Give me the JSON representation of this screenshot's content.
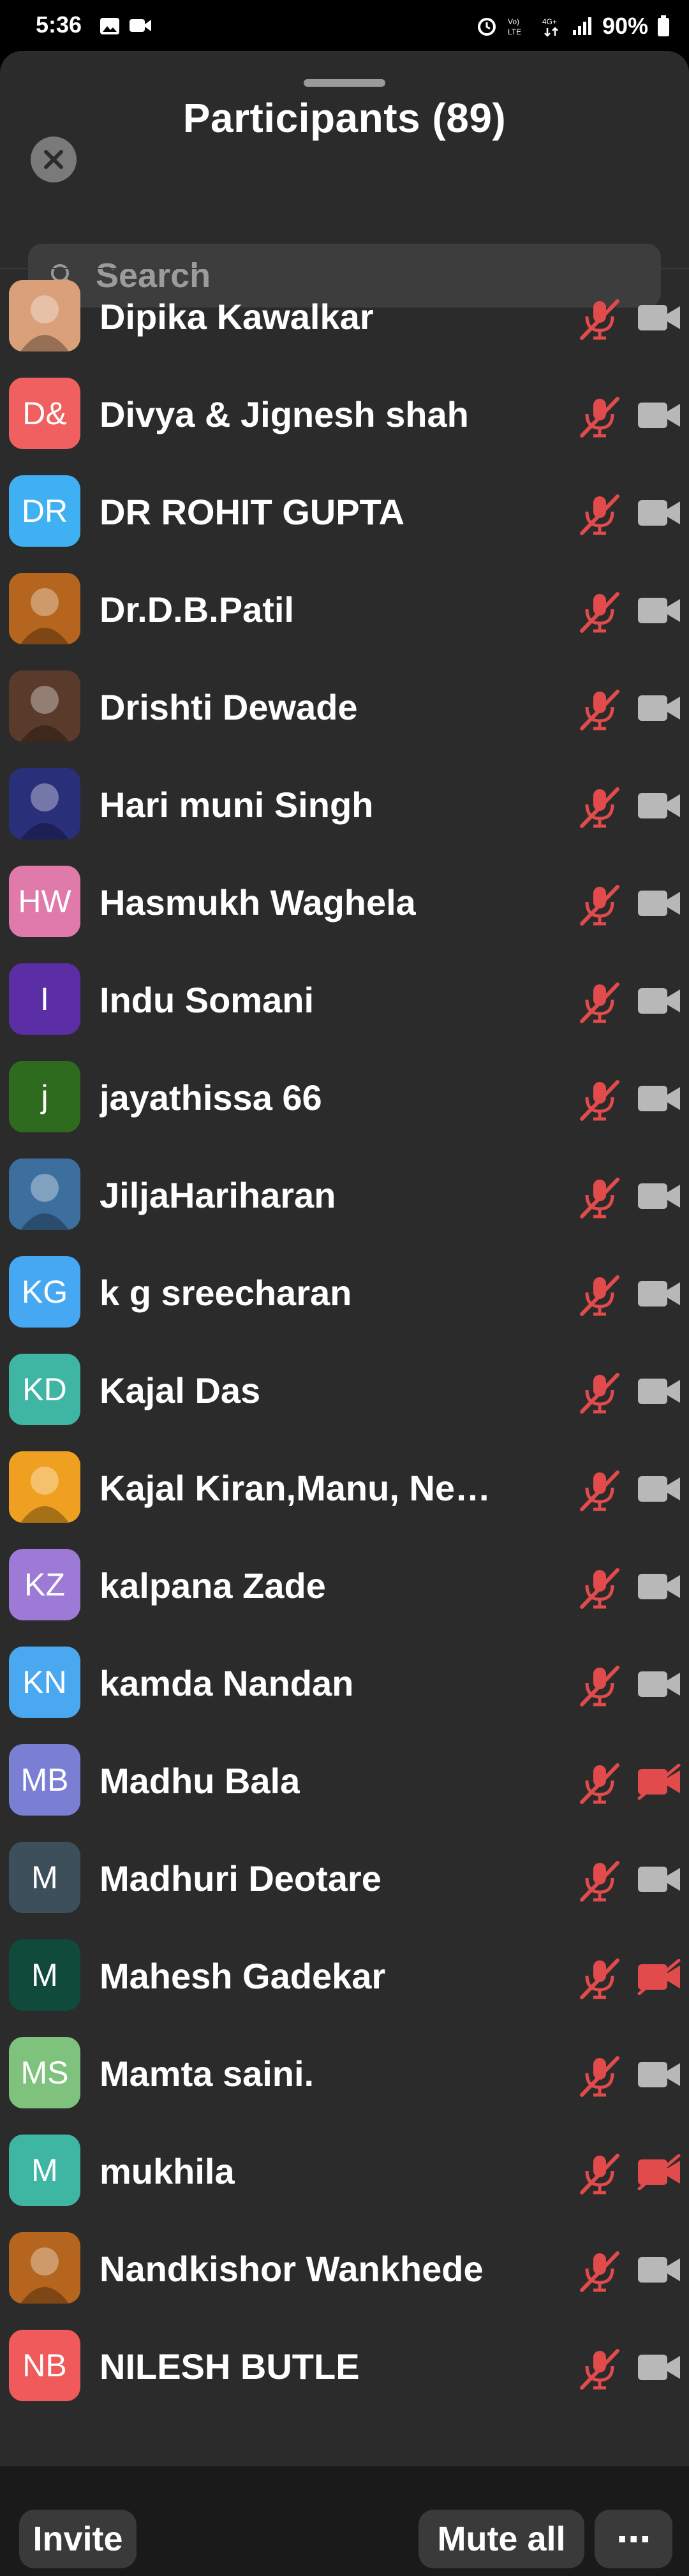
{
  "status_bar": {
    "time": "5:36",
    "battery": "90%"
  },
  "sheet": {
    "title": "Participants (89)",
    "search_placeholder": "Search"
  },
  "participants": [
    {
      "name": "Dipika Kawalkar",
      "initials": "",
      "avatar_color": "#d9a07a",
      "avatar_type": "photo",
      "video_off": false
    },
    {
      "name": "Divya & Jignesh shah",
      "initials": "D&",
      "avatar_color": "#f06060",
      "avatar_type": "initials",
      "video_off": false
    },
    {
      "name": "DR ROHIT GUPTA",
      "initials": "DR",
      "avatar_color": "#3fb1f2",
      "avatar_type": "initials",
      "video_off": false
    },
    {
      "name": "Dr.D.B.Patil",
      "initials": "",
      "avatar_color": "#b5651d",
      "avatar_type": "photo",
      "video_off": false
    },
    {
      "name": "Drishti Dewade",
      "initials": "",
      "avatar_color": "#5a3a2a",
      "avatar_type": "photo",
      "video_off": false
    },
    {
      "name": "Hari muni Singh",
      "initials": "",
      "avatar_color": "#2a2f7a",
      "avatar_type": "photo",
      "video_off": false
    },
    {
      "name": "Hasmukh Waghela",
      "initials": "HW",
      "avatar_color": "#e07aaa",
      "avatar_type": "initials",
      "video_off": false
    },
    {
      "name": "Indu Somani",
      "initials": "I",
      "avatar_color": "#5b2ea6",
      "avatar_type": "initials",
      "video_off": false
    },
    {
      "name": "jayathissa 66",
      "initials": "j",
      "avatar_color": "#2e6b1f",
      "avatar_type": "initials",
      "video_off": false
    },
    {
      "name": "JiljaHariharan",
      "initials": "",
      "avatar_color": "#3d6f9e",
      "avatar_type": "photo",
      "video_off": false
    },
    {
      "name": "k g sreecharan",
      "initials": "KG",
      "avatar_color": "#46a7f2",
      "avatar_type": "initials",
      "video_off": false
    },
    {
      "name": "Kajal Das",
      "initials": "KD",
      "avatar_color": "#3fb5a4",
      "avatar_type": "initials",
      "video_off": false
    },
    {
      "name": "Kajal Kiran,Manu, Neha…",
      "initials": "",
      "avatar_color": "#f0a020",
      "avatar_type": "photo",
      "video_off": false
    },
    {
      "name": "kalpana Zade",
      "initials": "KZ",
      "avatar_color": "#9c7ad6",
      "avatar_type": "initials",
      "video_off": false
    },
    {
      "name": "kamda Nandan",
      "initials": "KN",
      "avatar_color": "#4aa8f0",
      "avatar_type": "initials",
      "video_off": false
    },
    {
      "name": "Madhu Bala",
      "initials": "MB",
      "avatar_color": "#7b7fd4",
      "avatar_type": "initials",
      "video_off": true
    },
    {
      "name": "Madhuri Deotare",
      "initials": "M",
      "avatar_color": "#3d4f5a",
      "avatar_type": "initials",
      "video_off": false
    },
    {
      "name": "Mahesh Gadekar",
      "initials": "M",
      "avatar_color": "#0f4a3a",
      "avatar_type": "initials",
      "video_off": true
    },
    {
      "name": "Mamta saini.",
      "initials": "MS",
      "avatar_color": "#7ec27e",
      "avatar_type": "initials",
      "video_off": false
    },
    {
      "name": "mukhila",
      "initials": "M",
      "avatar_color": "#3fb5a4",
      "avatar_type": "initials",
      "video_off": true
    },
    {
      "name": "Nandkishor Wankhede",
      "initials": "",
      "avatar_color": "#b5651d",
      "avatar_type": "photo",
      "video_off": false
    },
    {
      "name": "NILESH BUTLE",
      "initials": "NB",
      "avatar_color": "#f05a5a",
      "avatar_type": "initials",
      "video_off": false
    }
  ],
  "bottom_bar": {
    "invite_label": "Invite",
    "mute_all_label": "Mute all",
    "more_label": "⋯"
  },
  "colors": {
    "muted_red": "#e24b4b",
    "video_gray": "#b8b8b8"
  }
}
